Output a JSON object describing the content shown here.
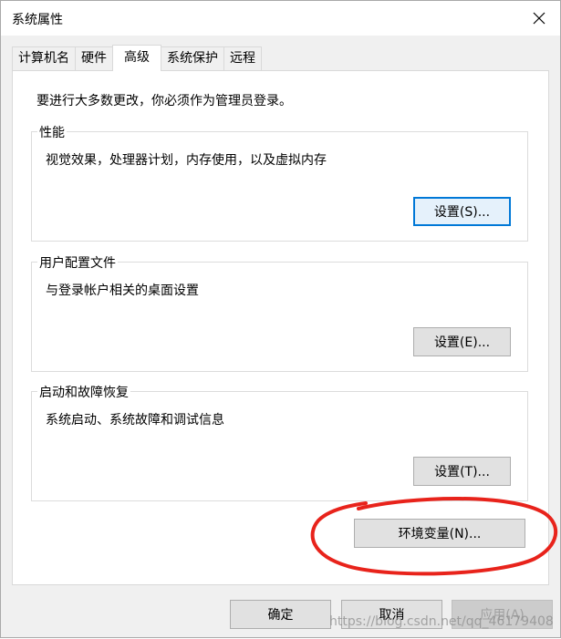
{
  "window": {
    "title": "系统属性"
  },
  "tabs": [
    {
      "label": "计算机名",
      "active": false
    },
    {
      "label": "硬件",
      "active": false
    },
    {
      "label": "高级",
      "active": true
    },
    {
      "label": "系统保护",
      "active": false
    },
    {
      "label": "远程",
      "active": false
    }
  ],
  "advanced": {
    "admin_note": "要进行大多数更改，你必须作为管理员登录。",
    "performance": {
      "title": "性能",
      "description": "视觉效果，处理器计划，内存使用，以及虚拟内存",
      "button": "设置(S)..."
    },
    "user_profiles": {
      "title": "用户配置文件",
      "description": "与登录帐户相关的桌面设置",
      "button": "设置(E)..."
    },
    "startup_recovery": {
      "title": "启动和故障恢复",
      "description": "系统启动、系统故障和调试信息",
      "button": "设置(T)..."
    },
    "env_button": "环境变量(N)..."
  },
  "footer": {
    "ok": "确定",
    "cancel": "取消",
    "apply": "应用(A)"
  },
  "watermark": "https://blog.csdn.net/qq_46179408",
  "colors": {
    "focus_border": "#0078d7",
    "annotation": "#e8231b"
  }
}
